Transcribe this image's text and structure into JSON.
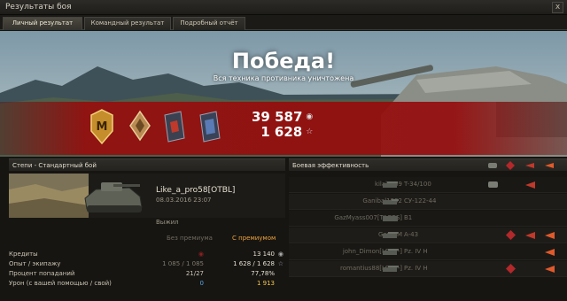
{
  "window": {
    "title": "Результаты боя",
    "close_label": "x"
  },
  "tabs": [
    "Личный результат",
    "Командный результат",
    "Подробный отчёт"
  ],
  "banner": {
    "result": "Победа!",
    "subtitle": "Вся техника противника уничтожена",
    "credits": "39 587",
    "experience": "1 628",
    "medals": [
      "mastery-badge-m",
      "class-badge",
      "battle-medal-1",
      "battle-medal-2"
    ]
  },
  "battle": {
    "header": "Степи - Стандартный бой",
    "player_name": "Like_a_pro58[OTBL]",
    "date": "08.03.2016 23:07",
    "status": "Выжил"
  },
  "columns": {
    "without_premium": "Без премиума",
    "with_premium": "С премиумом"
  },
  "stats": [
    {
      "label": "Кредиты",
      "without": "",
      "with": "13 140",
      "icon": "credits-icon"
    },
    {
      "label": "Опыт / экипажу",
      "without": "1 085 / 1 085",
      "with": "1 628 / 1 628",
      "icon": "xp-icon"
    },
    {
      "label": "Процент попаданий",
      "without": "21/27",
      "with": "77,78%",
      "icon": ""
    },
    {
      "label": "Урон (с вашей помощью / свой)",
      "without": "0",
      "with": "1 913",
      "icon": ""
    }
  ],
  "efficiency": {
    "header": "Боевая эффективность",
    "enemies": [
      {
        "name": "kilalaz69",
        "tank": "T-34/100"
      },
      {
        "name": "Ganibal1992",
        "tank": "СУ-122-44"
      },
      {
        "name": "GazMyass007[TAGES]",
        "tank": "B1"
      },
      {
        "name": "GovorM",
        "tank": "A-43"
      },
      {
        "name": "john_Dimon[LOM--]",
        "tank": "Pz. IV H"
      },
      {
        "name": "romantius88[LOM--]",
        "tank": "Pz. IV H"
      }
    ]
  },
  "colors": {
    "accent_orange": "#f0a33a",
    "damage_yellow": "#f3c54a",
    "assist_blue": "#5aa7e6",
    "victory_red": "#960c0c"
  }
}
